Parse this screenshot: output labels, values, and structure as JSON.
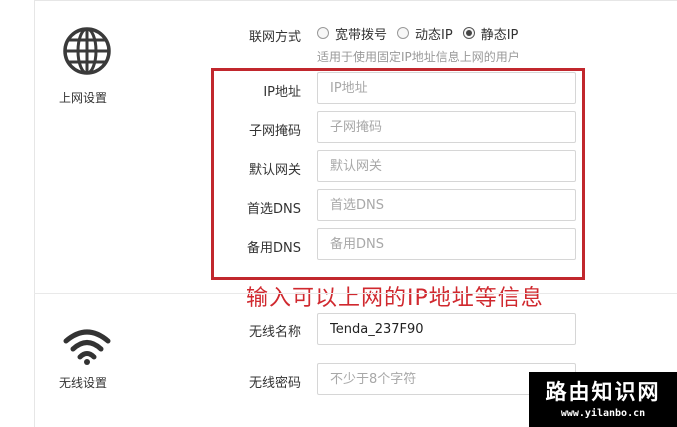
{
  "sections": {
    "internet": {
      "label": "上网设置",
      "icon": "globe-icon"
    },
    "wireless": {
      "label": "无线设置",
      "icon": "wifi-icon"
    }
  },
  "connection_type": {
    "label": "联网方式",
    "options": [
      {
        "label": "宽带拨号",
        "checked": false
      },
      {
        "label": "动态IP",
        "checked": false
      },
      {
        "label": "静态IP",
        "checked": true
      }
    ],
    "hint": "适用于使用固定IP地址信息上网的用户"
  },
  "static_fields": [
    {
      "label": "IP地址",
      "placeholder": "IP地址"
    },
    {
      "label": "子网掩码",
      "placeholder": "子网掩码"
    },
    {
      "label": "默认网关",
      "placeholder": "默认网关"
    },
    {
      "label": "首选DNS",
      "placeholder": "首选DNS"
    },
    {
      "label": "备用DNS",
      "placeholder": "备用DNS"
    }
  ],
  "annotation": "输入可以上网的IP地址等信息",
  "wireless": {
    "ssid_label": "无线名称",
    "ssid_value": "Tenda_237F90",
    "password_label": "无线密码",
    "password_placeholder": "不少于8个字符"
  },
  "watermark": {
    "title": "路由知识网",
    "url": "www.yilanbo.cn"
  },
  "colors": {
    "annotation_red": "#c1272d",
    "border": "#d6d6d6"
  }
}
